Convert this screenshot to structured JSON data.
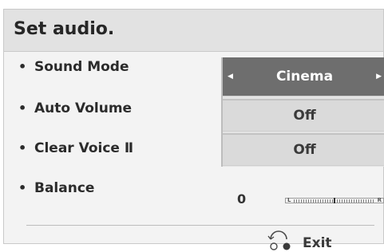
{
  "title": "Set audio.",
  "menu": [
    {
      "bullet": "•",
      "label": "Sound Mode"
    },
    {
      "bullet": "•",
      "label": "Auto Volume"
    },
    {
      "bullet": "•",
      "label": "Clear Voice Ⅱ"
    },
    {
      "bullet": "•",
      "label": "Balance"
    }
  ],
  "values": {
    "sound_mode": "Cinema",
    "auto_volume": "Off",
    "clear_voice": "Off",
    "balance": "0"
  },
  "balance_slider": {
    "left_label": "L",
    "right_label": "R",
    "level": 0.5
  },
  "footer": {
    "exit_label": "Exit",
    "exit_icon": "return-icon"
  },
  "colors": {
    "selected_background": "#6e6e6e",
    "panel_background": "#f3f3f3",
    "title_background": "#e2e2e2"
  }
}
